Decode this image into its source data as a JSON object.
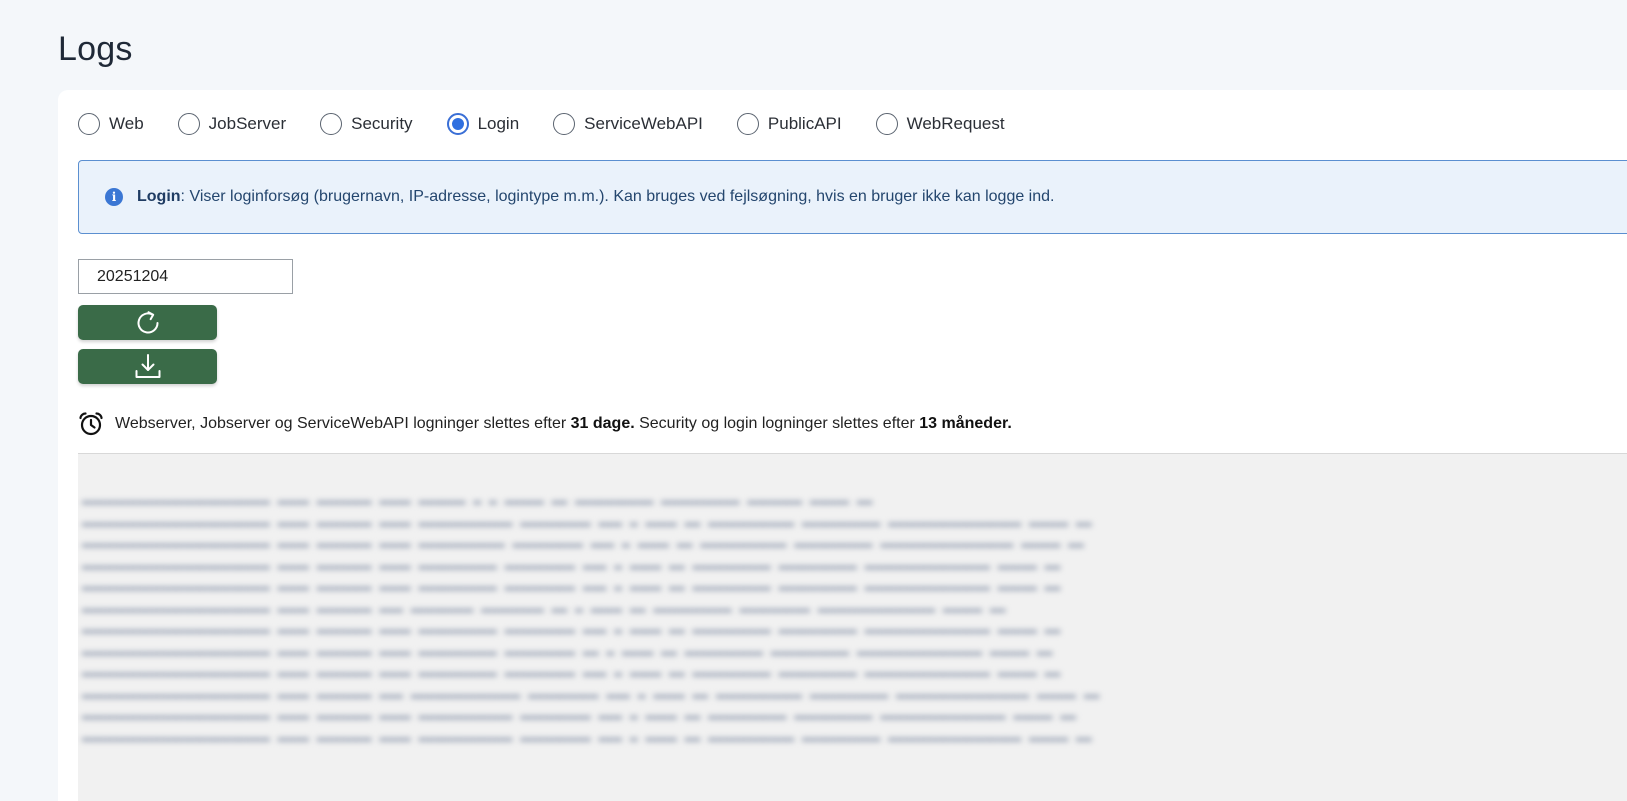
{
  "page": {
    "title": "Logs"
  },
  "log_types": [
    {
      "label": "Web",
      "selected": false
    },
    {
      "label": "JobServer",
      "selected": false
    },
    {
      "label": "Security",
      "selected": false
    },
    {
      "label": "Login",
      "selected": true
    },
    {
      "label": "ServiceWebAPI",
      "selected": false
    },
    {
      "label": "PublicAPI",
      "selected": false
    },
    {
      "label": "WebRequest",
      "selected": false
    }
  ],
  "info": {
    "title": "Login",
    "description": ": Viser loginforsøg (brugernavn, IP-adresse, logintype m.m.). Kan bruges ved fejlsøgning, hvis en bruger ikke kan logge ind.",
    "icon": "info-icon"
  },
  "date_filter": {
    "value": "20251204"
  },
  "actions": {
    "refresh_icon": "refresh-icon",
    "download_icon": "download-icon"
  },
  "retention": {
    "icon": "alarm-clock-icon",
    "part1": "Webserver, Jobserver og ServiceWebAPI logninger slettes efter ",
    "bold1": "31 dage.",
    "part2": " Security og login logninger slettes efter ",
    "bold2": "13 måneder."
  },
  "colors": {
    "accent_blue": "#2f6fe0",
    "info_border": "#5b8fd0",
    "info_bg": "#eaf2fb",
    "button_green": "#3a6b48"
  }
}
